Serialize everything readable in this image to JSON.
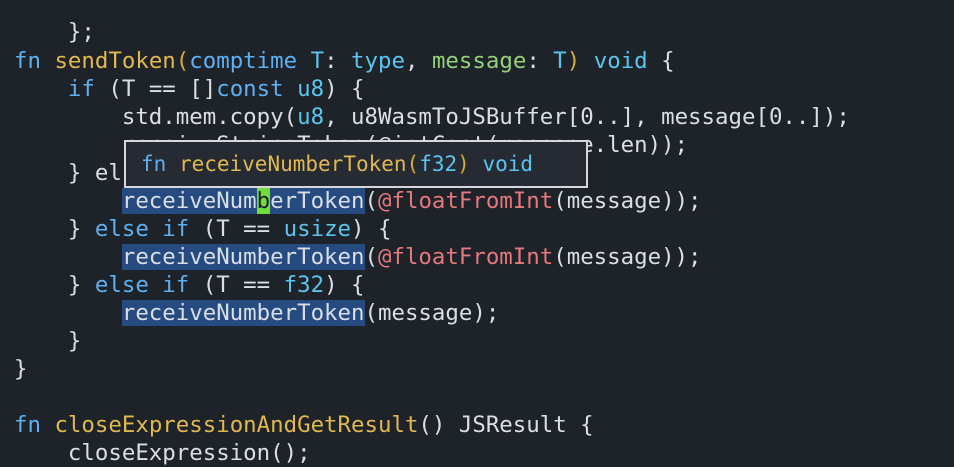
{
  "colors": {
    "background": "#1e2229",
    "keyword": "#5db0f2",
    "function": "#e0b84f",
    "type": "#5ac6ef",
    "parameter": "#95d07a",
    "builtin": "#e5787d",
    "highlight": "#254b80",
    "cursor": "#6fdc3c"
  },
  "code": {
    "l1": {
      "a": "};"
    },
    "l2": {
      "kw": "fn",
      "name": "sendToken",
      "p1": "(",
      "comptime": "comptime",
      "T": "T",
      "colon1": ": ",
      "type": "type",
      "comma": ", ",
      "message": "message",
      "colon2": ": ",
      "T2": "T",
      "p2": ")",
      "void": "void",
      "brace": "{"
    },
    "l3": {
      "if": "if",
      "a": "(T == []",
      "const": "const",
      "u8": "u8",
      "b": ") {"
    },
    "l4": {
      "a": "std.mem.copy(",
      "u8": "u8",
      "b": ", u8WasmToJSBuffer[",
      "zero1": "0",
      "c": "..], message[",
      "zero2": "0",
      "d": "..]);"
    },
    "l5": {
      "a": "        receiveStringToken(@intCast(message.len));"
    },
    "l6": {
      "a": "} else if (T == f32) {"
    },
    "l7": {
      "hl1": "receiveNum",
      "cur": "b",
      "hl2": "erToken",
      "p": "(",
      "builtin": "@floatFromInt",
      "rest": "(message));"
    },
    "l8": {
      "a": "} ",
      "else": "else",
      "if": "if",
      "b": " (T == ",
      "usize": "usize",
      "c": ") {"
    },
    "l9": {
      "hl": "receiveNumberToken",
      "p": "(",
      "builtin": "@floatFromInt",
      "rest": "(message));"
    },
    "l10": {
      "a": "} ",
      "else": "else",
      "if": "if",
      "b": " (T == ",
      "f32": "f32",
      "c": ") {"
    },
    "l11": {
      "hl": "receiveNumberToken",
      "rest": "(message);"
    },
    "l12": {
      "a": "}"
    },
    "l13": {
      "a": "}"
    },
    "l14": {
      "kw": "fn",
      "name": "closeExpressionAndGetResult",
      "rest": "() JSResult {"
    },
    "l15": {
      "a": "closeExpression();"
    }
  },
  "hover": {
    "kw": "fn",
    "name": "receiveNumberToken",
    "paren_open": "(",
    "type": "f32",
    "paren_close": ")",
    "ret": "void"
  }
}
